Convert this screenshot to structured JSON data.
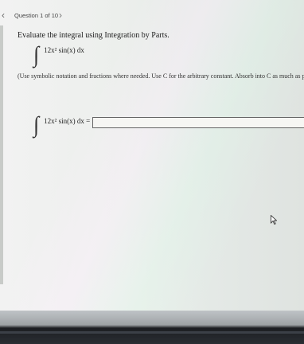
{
  "header": {
    "question_counter": "Question 1 of 10",
    "prev_glyph": "‹",
    "next_glyph": "›"
  },
  "problem": {
    "instruction": "Evaluate the integral using Integration by Parts.",
    "integral_symbol": "∫",
    "integrand_html": "12x² sin(x) dx",
    "note": "(Use symbolic notation and fractions where needed. Use C for the arbitrary constant. Absorb into C as much as possible.)"
  },
  "answer": {
    "lhs": "12x² sin(x) dx =",
    "value": ""
  },
  "icons": {
    "prev": "chevron-left-icon",
    "next": "chevron-right-icon",
    "cursor": "mouse-pointer-icon"
  }
}
